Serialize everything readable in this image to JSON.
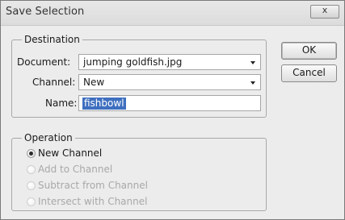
{
  "window": {
    "title": "Save Selection",
    "close_glyph": "x"
  },
  "destination": {
    "legend": "Destination",
    "document_label": "Document:",
    "document_value": "jumping goldfish.jpg",
    "channel_label": "Channel:",
    "channel_value": "New",
    "name_label": "Name:",
    "name_value": "fishbowl"
  },
  "operation": {
    "legend": "Operation",
    "options": [
      {
        "label": "New Channel",
        "selected": true,
        "enabled": true
      },
      {
        "label": "Add to Channel",
        "selected": false,
        "enabled": false
      },
      {
        "label": "Subtract from Channel",
        "selected": false,
        "enabled": false
      },
      {
        "label": "Intersect with Channel",
        "selected": false,
        "enabled": false
      }
    ]
  },
  "buttons": {
    "ok": "OK",
    "cancel": "Cancel"
  }
}
